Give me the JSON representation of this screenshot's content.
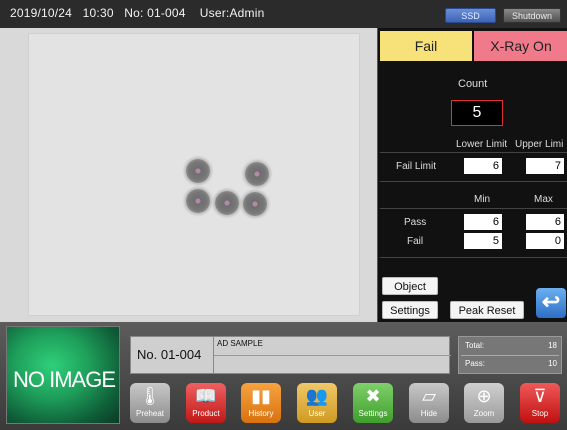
{
  "status_bar": {
    "text": "2019/10/24   10:30   No: 01-004    User:Admin",
    "ssd_label": "SSD",
    "shutdown_label": "Shutdown"
  },
  "panel": {
    "fail_tab": "Fail",
    "xray_tab": "X-Ray On",
    "count_label": "Count",
    "count_value": "5",
    "lower_limit_label": "Lower Limit",
    "upper_limit_label": "Upper Limi",
    "fail_limit_label": "Fail Limit",
    "fail_limit_lower": "6",
    "fail_limit_upper": "7",
    "min_label": "Min",
    "max_label": "Max",
    "pass_label": "Pass",
    "pass_min": "6",
    "pass_max": "6",
    "fail_label": "Fail",
    "fail_min": "5",
    "fail_max": "0",
    "object_button": "Object",
    "settings_button": "Settings",
    "peak_reset_button": "Peak Reset"
  },
  "product": {
    "no_image_text": "NO IMAGE",
    "number": "No. 01-004",
    "name": "AD SAMPLE",
    "total_label": "Total:",
    "total_value": "18",
    "pass_label": "Pass:",
    "pass_value": "10"
  },
  "toolbar": {
    "preheat": "Preheat",
    "product": "Product",
    "history": "History",
    "user": "User",
    "settings": "Settings",
    "hide": "Hide",
    "zoom": "Zoom",
    "stop": "Stop"
  },
  "icons": {
    "preheat": "thermometer-icon",
    "product": "book-icon",
    "history": "bar-chart-icon",
    "user": "users-icon",
    "settings": "tools-icon",
    "hide": "hide-icon",
    "zoom": "magnifier-icon",
    "stop": "stop-icon",
    "return": "return-arrow-icon"
  },
  "colors": {
    "fail_tab": "#f7e27a",
    "xray_tab": "#f07a8a",
    "count_border": "#e03030"
  }
}
